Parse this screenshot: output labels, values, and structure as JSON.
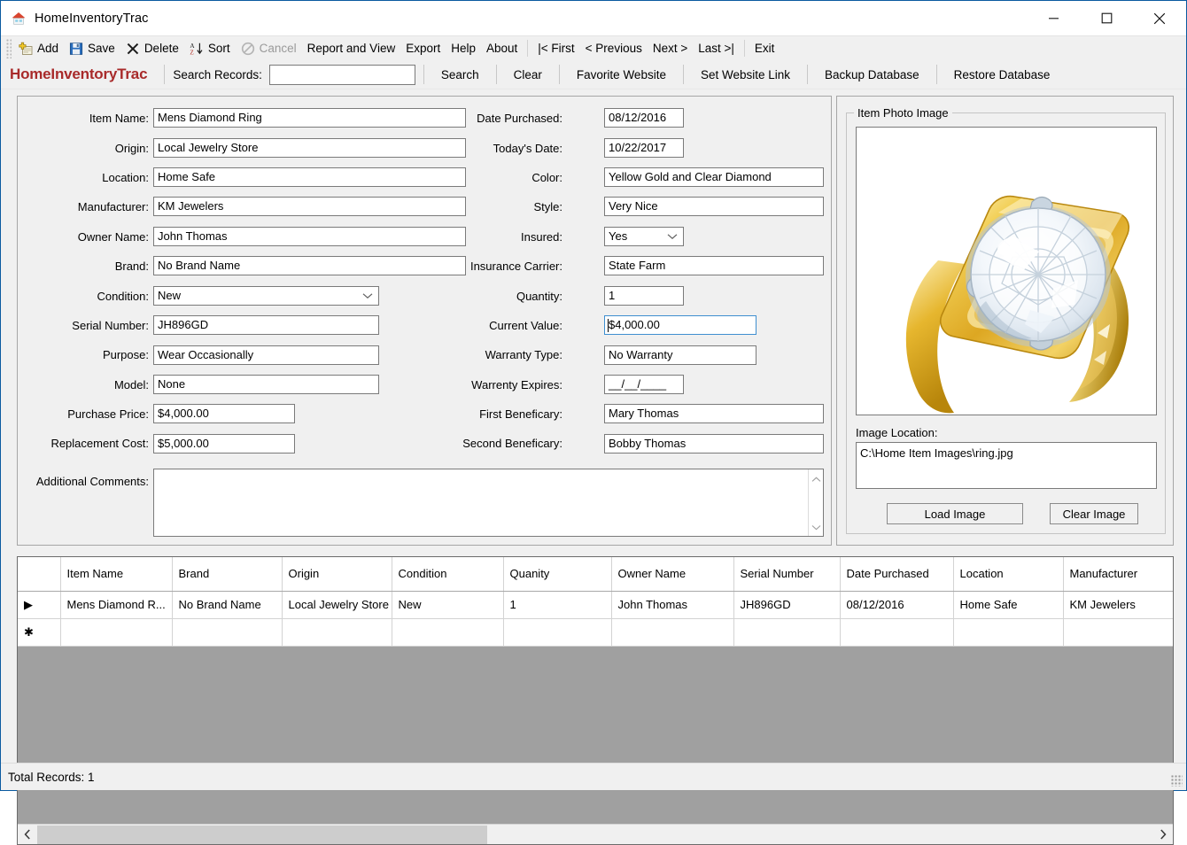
{
  "window": {
    "title": "HomeInventoryTrac",
    "icon": "house-icon",
    "minimize": "minimize-icon",
    "maximize": "maximize-icon",
    "close": "close-icon"
  },
  "menu": {
    "items": [
      {
        "label": "Add",
        "icon": "add-record-icon",
        "enabled": true
      },
      {
        "label": "Save",
        "icon": "floppy-disk-icon",
        "enabled": true
      },
      {
        "label": "Delete",
        "icon": "x-cross-icon",
        "enabled": true
      },
      {
        "label": "Sort",
        "icon": "sort-az-icon",
        "enabled": true
      },
      {
        "label": "Cancel",
        "icon": "no-entry-icon",
        "enabled": false
      },
      {
        "label": "Report and View",
        "icon": "",
        "enabled": true
      },
      {
        "label": "Export",
        "icon": "",
        "enabled": true
      },
      {
        "label": "Help",
        "icon": "",
        "enabled": true
      },
      {
        "label": "About",
        "icon": "",
        "enabled": true
      }
    ],
    "nav": [
      {
        "label": "|< First"
      },
      {
        "label": "< Previous"
      },
      {
        "label": "Next >"
      },
      {
        "label": "Last >|"
      }
    ],
    "exit": "Exit"
  },
  "search_strip": {
    "brand": "HomeInventoryTrac",
    "brand_color": "#a82a2a",
    "label": "Search Records:",
    "value": "",
    "placeholder": "",
    "buttons": [
      "Search",
      "Clear",
      "Favorite Website",
      "Set Website Link",
      "Backup Database",
      "Restore Database"
    ]
  },
  "form": {
    "left_column": [
      {
        "label": "Item Name:",
        "value": "Mens Diamond Ring",
        "type": "text"
      },
      {
        "label": "Origin:",
        "value": "Local Jewelry Store",
        "type": "text"
      },
      {
        "label": "Location:",
        "value": "Home Safe",
        "type": "text"
      },
      {
        "label": "Manufacturer:",
        "value": "KM Jewelers",
        "type": "text"
      },
      {
        "label": "Owner Name:",
        "value": "John Thomas",
        "type": "text"
      },
      {
        "label": "Brand:",
        "value": "No Brand Name",
        "type": "text"
      },
      {
        "label": "Condition:",
        "value": "New",
        "type": "combo"
      },
      {
        "label": "Serial Number:",
        "value": "JH896GD",
        "type": "text"
      },
      {
        "label": "Purpose:",
        "value": "Wear Occasionally",
        "type": "text"
      },
      {
        "label": "Model:",
        "value": "None",
        "type": "text"
      },
      {
        "label": "Purchase Price:",
        "value": "$4,000.00",
        "type": "text"
      },
      {
        "label": "Replacement Cost:",
        "value": "$5,000.00",
        "type": "text"
      }
    ],
    "right_column": [
      {
        "label": "Date Purchased:",
        "value": "08/12/2016",
        "type": "text"
      },
      {
        "label": "Today's Date:",
        "value": "10/22/2017",
        "type": "text"
      },
      {
        "label": "Color:",
        "value": "Yellow Gold and Clear Diamond",
        "type": "text"
      },
      {
        "label": "Style:",
        "value": "Very Nice",
        "type": "text"
      },
      {
        "label": "Insured:",
        "value": "Yes",
        "type": "combo"
      },
      {
        "label": "Insurance Carrier:",
        "value": "State Farm",
        "type": "text"
      },
      {
        "label": "Quantity:",
        "value": "1",
        "type": "text"
      },
      {
        "label": "Current Value:",
        "value": "$4,000.00",
        "type": "text",
        "focused": true
      },
      {
        "label": "Warranty Type:",
        "value": "No Warranty",
        "type": "text"
      },
      {
        "label": "Warrenty Expires:",
        "value": "__/__/____",
        "type": "text"
      },
      {
        "label": "First Beneficary:",
        "value": "Mary Thomas",
        "type": "text"
      },
      {
        "label": "Second Beneficary:",
        "value": "Bobby Thomas",
        "type": "text"
      }
    ],
    "comments": {
      "label": "Additional Comments:",
      "value": ""
    }
  },
  "photo_panel": {
    "groupbox_title": "Item Photo Image",
    "image_alt": "mens-gold-diamond-ring-photo",
    "image_location_label": "Image Location:",
    "image_location_value": "C:\\Home Item Images\\ring.jpg",
    "load_button": "Load Image",
    "clear_button": "Clear Image"
  },
  "grid": {
    "columns": [
      "Item Name",
      "Brand",
      "Origin",
      "Condition",
      "Quanity",
      "Owner Name",
      "Serial Number",
      "Date\nPurchased",
      "Location",
      "Manufacturer"
    ],
    "rows": [
      {
        "marker": "▶",
        "cells": [
          "Mens Diamond R...",
          "No Brand Name",
          "Local Jewelry Store",
          "New",
          "1",
          "John Thomas",
          "JH896GD",
          "08/12/2016",
          "Home Safe",
          "KM Jewelers"
        ],
        "selected_cell_index": 0
      },
      {
        "marker": "✱",
        "cells": [
          "",
          "",
          "",
          "",
          "",
          "",
          "",
          "",
          "",
          ""
        ],
        "selected_cell_index": -1
      }
    ],
    "selection_color": "#0e7ad4",
    "scroll_left_icon": "chevron-left-icon",
    "scroll_right_icon": "chevron-right-icon"
  },
  "statusbar": {
    "total_records": "Total Records: 1"
  }
}
